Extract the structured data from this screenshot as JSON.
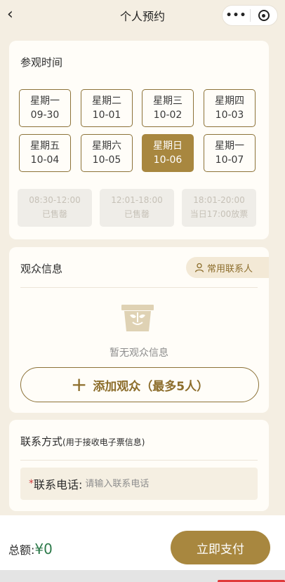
{
  "nav": {
    "title": "个人预约",
    "back_icon": "chevron-left-icon",
    "more_label": "•••"
  },
  "visit_time": {
    "title": "参观时间",
    "dates": [
      {
        "day": "星期一",
        "date": "09-30",
        "selected": false
      },
      {
        "day": "星期二",
        "date": "10-01",
        "selected": false
      },
      {
        "day": "星期三",
        "date": "10-02",
        "selected": false
      },
      {
        "day": "星期四",
        "date": "10-03",
        "selected": false
      },
      {
        "day": "星期五",
        "date": "10-04",
        "selected": false
      },
      {
        "day": "星期六",
        "date": "10-05",
        "selected": false
      },
      {
        "day": "星期日",
        "date": "10-06",
        "selected": true
      },
      {
        "day": "星期一",
        "date": "10-07",
        "selected": false
      }
    ],
    "slots": [
      {
        "time": "08:30-12:00",
        "status": "已售罄"
      },
      {
        "time": "12:01-18:00",
        "status": "已售罄"
      },
      {
        "time": "18:01-20:00",
        "status": "当日17:00放票"
      }
    ]
  },
  "audience": {
    "title": "观众信息",
    "contacts_label": "常用联系人",
    "empty_text": "暂无观众信息",
    "add_plus": "+",
    "add_label": "添加观众（最多5人）"
  },
  "contact": {
    "title": "联系方式",
    "title_note": "(用于接收电子票信息)",
    "required_mark": "*",
    "phone_label": "联系电话:",
    "phone_placeholder": "请输入联系电话",
    "phone_value": ""
  },
  "footer": {
    "total_label": "总额:",
    "total_amount": "¥0",
    "pay_label": "立即支付"
  },
  "colors": {
    "accent": "#a8873f",
    "background": "#f4eee2",
    "card": "#fffdf8",
    "price": "#2d7a4a",
    "required": "#d23c3c"
  }
}
